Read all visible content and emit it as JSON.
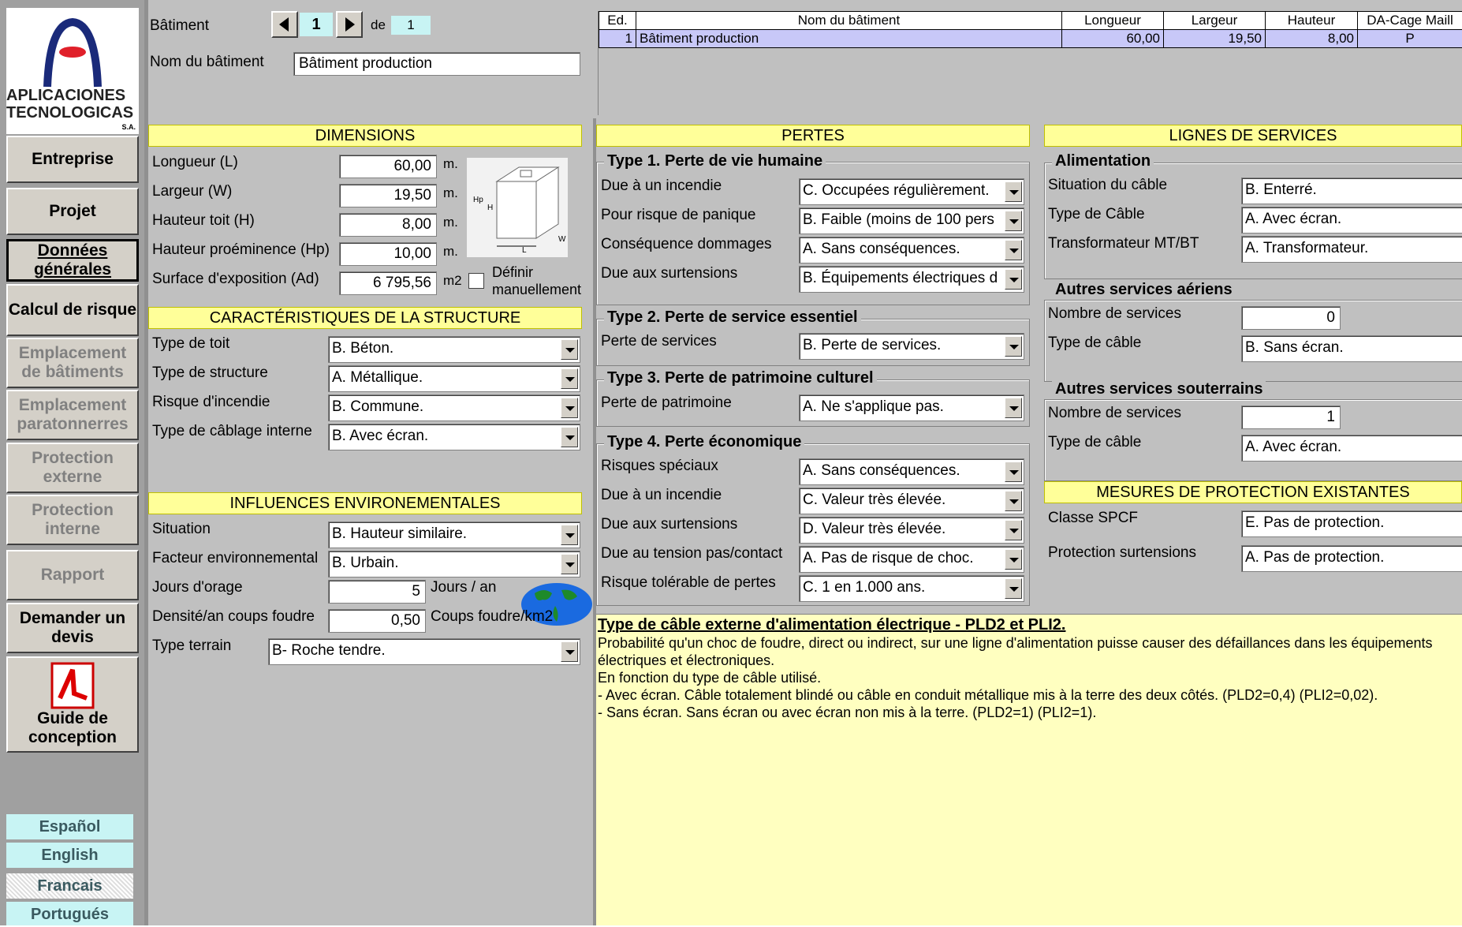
{
  "logo": {
    "line1": "APLICACIONES",
    "line2": "TECNOLOGICAS",
    "suffix": "S.A."
  },
  "nav": [
    "Entreprise",
    "Projet",
    "Données générales",
    "Calcul de risque",
    "Emplacement de bâtiments",
    "Emplacement paratonnerres",
    "Protection externe",
    "Protection interne",
    "Rapport",
    "Demander un devis",
    "Guide de conception"
  ],
  "languages": [
    "Español",
    "English",
    "Francais",
    "Portugués"
  ],
  "building": {
    "label": "Bâtiment",
    "index": "1",
    "of_label": "de",
    "total": "1",
    "name_label": "Nom du bâtiment",
    "name": "Bâtiment production"
  },
  "table": {
    "headers": [
      "Ed.",
      "Nom du bâtiment",
      "Longueur",
      "Largeur",
      "Hauteur",
      "DA-Cage Maill"
    ],
    "rows": [
      [
        "1",
        "Bâtiment production",
        "60,00",
        "19,50",
        "8,00",
        "P"
      ]
    ]
  },
  "dimensions": {
    "title": "DIMENSIONS",
    "length_label": "Longueur (L)",
    "length": "60,00",
    "width_label": "Largeur (W)",
    "width": "19,50",
    "height_label": "Hauteur toit (H)",
    "height": "8,00",
    "hp_label": "Hauteur proéminence (Hp)",
    "hp": "10,00",
    "area_label": "Surface d'exposition (Ad)",
    "area": "6 795,56",
    "unit_m": "m.",
    "unit_m2": "m2",
    "manual_label": "Définir manuellement"
  },
  "structure": {
    "title": "CARACTÉRISTIQUES DE LA STRUCTURE",
    "roof_label": "Type de toit",
    "roof": "B. Béton.",
    "struct_label": "Type de structure",
    "struct": "A. Métallique.",
    "fire_label": "Risque d'incendie",
    "fire": "B. Commune.",
    "wiring_label": "Type de câblage interne",
    "wiring": "B. Avec écran."
  },
  "environment": {
    "title": "INFLUENCES ENVIRONEMENTALES",
    "situation_label": "Situation",
    "situation": "B. Hauteur similaire.",
    "factor_label": "Facteur environnemental",
    "factor": "B. Urbain.",
    "storm_label": "Jours d'orage",
    "storm": "5",
    "storm_unit": "Jours / an",
    "density_label": "Densité/an coups foudre",
    "density": "0,50",
    "density_unit": "Coups foudre/km2",
    "terrain_label": "Type terrain",
    "terrain": "B- Roche tendre."
  },
  "losses": {
    "title": "PERTES",
    "t1": "Type 1. Perte de vie humaine",
    "t1_fire_label": "Due à un incendie",
    "t1_fire": "C. Occupées régulièrement.",
    "t1_panic_label": "Pour risque de panique",
    "t1_panic": "B. Faible (moins de 100 pers",
    "t1_cons_label": "Conséquence dommages",
    "t1_cons": "A. Sans conséquences.",
    "t1_surge_label": "Due aux surtensions",
    "t1_surge": "B. Équipements électriques d",
    "t2": "Type 2. Perte de service essentiel",
    "t2_label": "Perte de services",
    "t2_val": "B. Perte de services.",
    "t3": "Type 3. Perte de patrimoine culturel",
    "t3_label": "Perte de patrimoine",
    "t3_val": "A. Ne s'applique pas.",
    "t4": "Type 4. Perte économique",
    "t4_special_label": "Risques spéciaux",
    "t4_special": "A. Sans conséquences.",
    "t4_fire_label": "Due à un incendie",
    "t4_fire": "C. Valeur très élevée.",
    "t4_surge_label": "Due aux surtensions",
    "t4_surge": "D. Valeur très élevée.",
    "t4_step_label": "Due au tension pas/contact",
    "t4_step": "A. Pas de risque de choc.",
    "t4_tol_label": "Risque tolérable de pertes",
    "t4_tol": "C. 1 en 1.000 ans."
  },
  "services": {
    "title": "LIGNES DE SERVICES",
    "power": "Alimentation",
    "cable_sit_label": "Situation du câble",
    "cable_sit": "B. Enterré.",
    "cable_type_label": "Type de Câble",
    "cable_type": "A. Avec écran.",
    "transfo_label": "Transformateur MT/BT",
    "transfo": "A. Transformateur.",
    "aerial": "Autres services aériens",
    "aerial_n_label": "Nombre de services",
    "aerial_n": "0",
    "aerial_cable_label": "Type de câble",
    "aerial_cable": "B. Sans écran.",
    "under": "Autres services souterrains",
    "under_n_label": "Nombre de services",
    "under_n": "1",
    "under_cable_label": "Type de câble",
    "under_cable": "A. Avec écran."
  },
  "protection": {
    "title": "MESURES DE PROTECTION EXISTANTES",
    "spcf_label": "Classe SPCF",
    "spcf": "E. Pas de protection.",
    "surge_label": "Protection surtensions",
    "surge": "A. Pas de protection."
  },
  "help": {
    "title": "Type de câble externe d'alimentation électrique - PLD2 et PLI2.",
    "p1": "Probabilité qu'un choc de foudre, direct ou indirect, sur une ligne d'alimentation puisse causer des défaillances dans les équipements électriques et électroniques.",
    "p2": "En fonction du type de câble utilisé.",
    "p3": "- Avec écran. Câble totalement blindé ou câble en conduit métallique mis à la terre des deux côtés.  (PLD2=0,4) (PLI2=0,02).",
    "p4": "- Sans écran. Sans écran ou avec écran non mis à la terre.  (PLD2=1) (PLI2=1)."
  }
}
